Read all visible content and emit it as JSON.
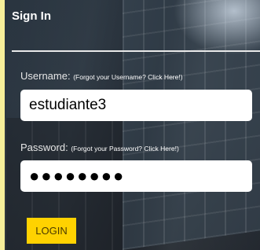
{
  "signin": {
    "title": "Sign In",
    "username": {
      "label": "Username:",
      "hint": "(Forgot your Username? Click Here!)",
      "value": "estudiante3"
    },
    "password": {
      "label": "Password:",
      "hint": "(Forgot your Password? Click Here!)",
      "value": "●●●●●●●●"
    },
    "login_label": "LOGIN"
  },
  "colors": {
    "page_background": "#f7ef9a",
    "login_button": "#ffd200",
    "field_background": "#ffffff"
  }
}
